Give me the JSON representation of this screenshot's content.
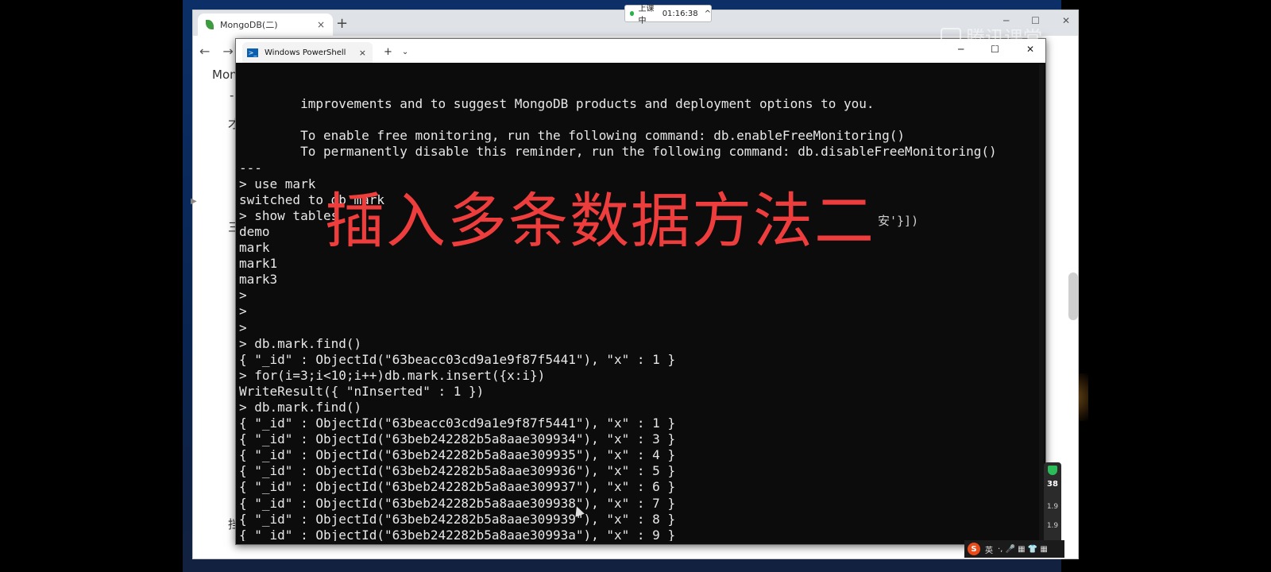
{
  "browser": {
    "tab_title": "MongoDB(二)",
    "tab_close": "×",
    "new_tab": "+",
    "nav_back": "←",
    "nav_forward": "→",
    "nav_partial": "C",
    "win_min": "─",
    "win_max": "☐",
    "win_close": "✕",
    "page_fragments": [
      "Mong",
      "-",
      "才",
      "三",
      "挡"
    ]
  },
  "recording": {
    "status": "上课中",
    "time": "01:16:38",
    "arrow": "^"
  },
  "watermark": "腾讯课堂",
  "powershell": {
    "tab_title": "Windows PowerShell",
    "tab_close": "×",
    "new_tab": "+",
    "dropdown": "⌄",
    "win_min": "─",
    "win_max": "☐",
    "win_close": "✕",
    "lines": [
      "        improvements and to suggest MongoDB products and deployment options to you.",
      "",
      "        To enable free monitoring, run the following command: db.enableFreeMonitoring()",
      "        To permanently disable this reminder, run the following command: db.disableFreeMonitoring()",
      "---",
      "> use mark",
      "switched to db mark",
      "> show tables",
      "demo",
      "mark",
      "mark1",
      "mark3",
      ">",
      ">",
      ">",
      "> db.mark.find()",
      "{ \"_id\" : ObjectId(\"63beacc03cd9a1e9f87f5441\"), \"x\" : 1 }",
      "> for(i=3;i<10;i++)db.mark.insert({x:i})",
      "WriteResult({ \"nInserted\" : 1 })",
      "> db.mark.find()",
      "{ \"_id\" : ObjectId(\"63beacc03cd9a1e9f87f5441\"), \"x\" : 1 }",
      "{ \"_id\" : ObjectId(\"63beb242282b5a8aae309934\"), \"x\" : 3 }",
      "{ \"_id\" : ObjectId(\"63beb242282b5a8aae309935\"), \"x\" : 4 }",
      "{ \"_id\" : ObjectId(\"63beb242282b5a8aae309936\"), \"x\" : 5 }",
      "{ \"_id\" : ObjectId(\"63beb242282b5a8aae309937\"), \"x\" : 6 }",
      "{ \"_id\" : ObjectId(\"63beb242282b5a8aae309938\"), \"x\" : 7 }",
      "{ \"_id\" : ObjectId(\"63beb242282b5a8aae309939\"), \"x\" : 8 }",
      "{ \"_id\" : ObjectId(\"63beb242282b5a8aae30993a\"), \"x\" : 9 }"
    ],
    "prompt": "> ",
    "partial_text": "安'}])",
    "overlay_text": "插入多条数据方法二"
  },
  "side_widget": {
    "percent": "38",
    "items": [
      "1.9",
      "1.9"
    ]
  },
  "ime": {
    "logo": "S",
    "lang": "英",
    "symbols": "·, 🎤 ▦ 👕 ▦"
  }
}
